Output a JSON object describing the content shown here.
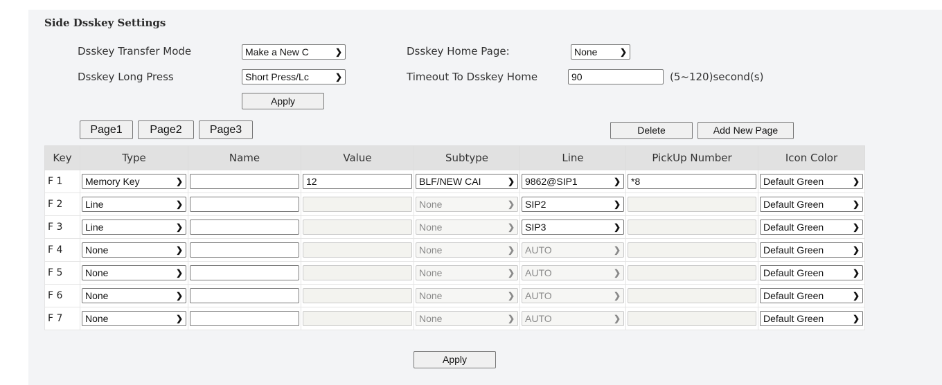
{
  "section_title": "Side Dsskey Settings",
  "settings": {
    "transfer_mode_label": "Dsskey Transfer Mode",
    "transfer_mode_value": "Make a New C",
    "long_press_label": "Dsskey Long Press",
    "long_press_value": "Short Press/Lc",
    "home_page_label": "Dsskey Home Page:",
    "home_page_value": "None",
    "timeout_label": "Timeout To Dsskey Home",
    "timeout_value": "90",
    "timeout_hint": "(5~120)second(s)",
    "apply_label": "Apply"
  },
  "pages": [
    "Page1",
    "Page2",
    "Page3"
  ],
  "delete_label": "Delete",
  "add_page_label": "Add New Page",
  "table": {
    "headers": [
      "Key",
      "Type",
      "Name",
      "Value",
      "Subtype",
      "Line",
      "PickUp Number",
      "Icon Color"
    ],
    "rows": [
      {
        "key": "F 1",
        "type": "Memory Key",
        "name": "",
        "value": "12",
        "subtype": "BLF/NEW CAI",
        "line": "9862@SIP1",
        "pickup": "*8",
        "color": "Default Green",
        "subtype_disabled": false,
        "line_disabled": false,
        "value_disabled": false,
        "pickup_disabled": false
      },
      {
        "key": "F 2",
        "type": "Line",
        "name": "",
        "value": "",
        "subtype": "None",
        "line": "SIP2",
        "pickup": "",
        "color": "Default Green",
        "subtype_disabled": true,
        "line_disabled": false,
        "value_disabled": true,
        "pickup_disabled": true
      },
      {
        "key": "F 3",
        "type": "Line",
        "name": "",
        "value": "",
        "subtype": "None",
        "line": "SIP3",
        "pickup": "",
        "color": "Default Green",
        "subtype_disabled": true,
        "line_disabled": false,
        "value_disabled": true,
        "pickup_disabled": true
      },
      {
        "key": "F 4",
        "type": "None",
        "name": "",
        "value": "",
        "subtype": "None",
        "line": "AUTO",
        "pickup": "",
        "color": "Default Green",
        "subtype_disabled": true,
        "line_disabled": true,
        "value_disabled": true,
        "pickup_disabled": true
      },
      {
        "key": "F 5",
        "type": "None",
        "name": "",
        "value": "",
        "subtype": "None",
        "line": "AUTO",
        "pickup": "",
        "color": "Default Green",
        "subtype_disabled": true,
        "line_disabled": true,
        "value_disabled": true,
        "pickup_disabled": true
      },
      {
        "key": "F 6",
        "type": "None",
        "name": "",
        "value": "",
        "subtype": "None",
        "line": "AUTO",
        "pickup": "",
        "color": "Default Green",
        "subtype_disabled": true,
        "line_disabled": true,
        "value_disabled": true,
        "pickup_disabled": true
      },
      {
        "key": "F 7",
        "type": "None",
        "name": "",
        "value": "",
        "subtype": "None",
        "line": "AUTO",
        "pickup": "",
        "color": "Default Green",
        "subtype_disabled": true,
        "line_disabled": true,
        "value_disabled": true,
        "pickup_disabled": true
      }
    ]
  },
  "bottom_apply_label": "Apply",
  "chevron_icon": "chevron-down-icon",
  "colors": {
    "panel_bg": "#f3f4f6",
    "header_bg": "#e1e1e1",
    "button_bg": "#f0f0f0"
  }
}
